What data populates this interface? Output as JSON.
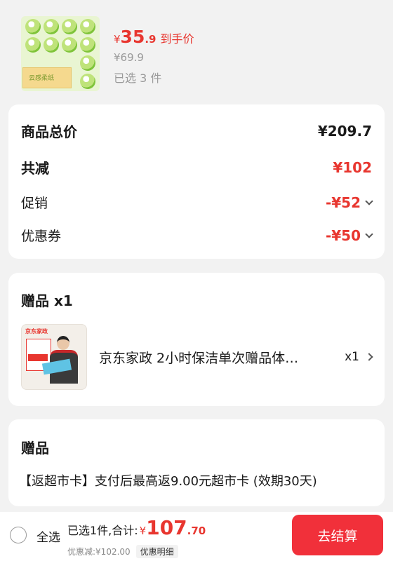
{
  "product": {
    "image_label": "云感柔纸",
    "price_yen": "¥",
    "price_int": "35",
    "price_dec": ".9",
    "price_tag": "到手价",
    "original_price": "¥69.9",
    "selected_count": "已选 3 件"
  },
  "summary": {
    "total_label": "商品总价",
    "total_value": "¥209.7",
    "reduce_label": "共减",
    "reduce_value": "¥102",
    "promo_label": "促销",
    "promo_value": "-¥52",
    "coupon_label": "优惠券",
    "coupon_value": "-¥50"
  },
  "gift": {
    "title": "赠品 x1",
    "thumb_brand": "京东家政",
    "item_name": "京东家政 2小时保洁单次赠品体…",
    "item_qty": "x1"
  },
  "gift2": {
    "title": "赠品",
    "description": "【返超市卡】支付后最高返9.00元超市卡 (效期30天)"
  },
  "bottom": {
    "select_all": "全选",
    "total_text": "已选1件,合计:",
    "total_yen": "¥",
    "total_int": "107",
    "total_dec": ".70",
    "discount_text": "优惠减:¥102.00",
    "detail_label": "优惠明细",
    "checkout_label": "去结算"
  },
  "colors": {
    "accent": "#e8362f",
    "checkout_button": "#f1303a",
    "background": "#f2f2f2"
  }
}
